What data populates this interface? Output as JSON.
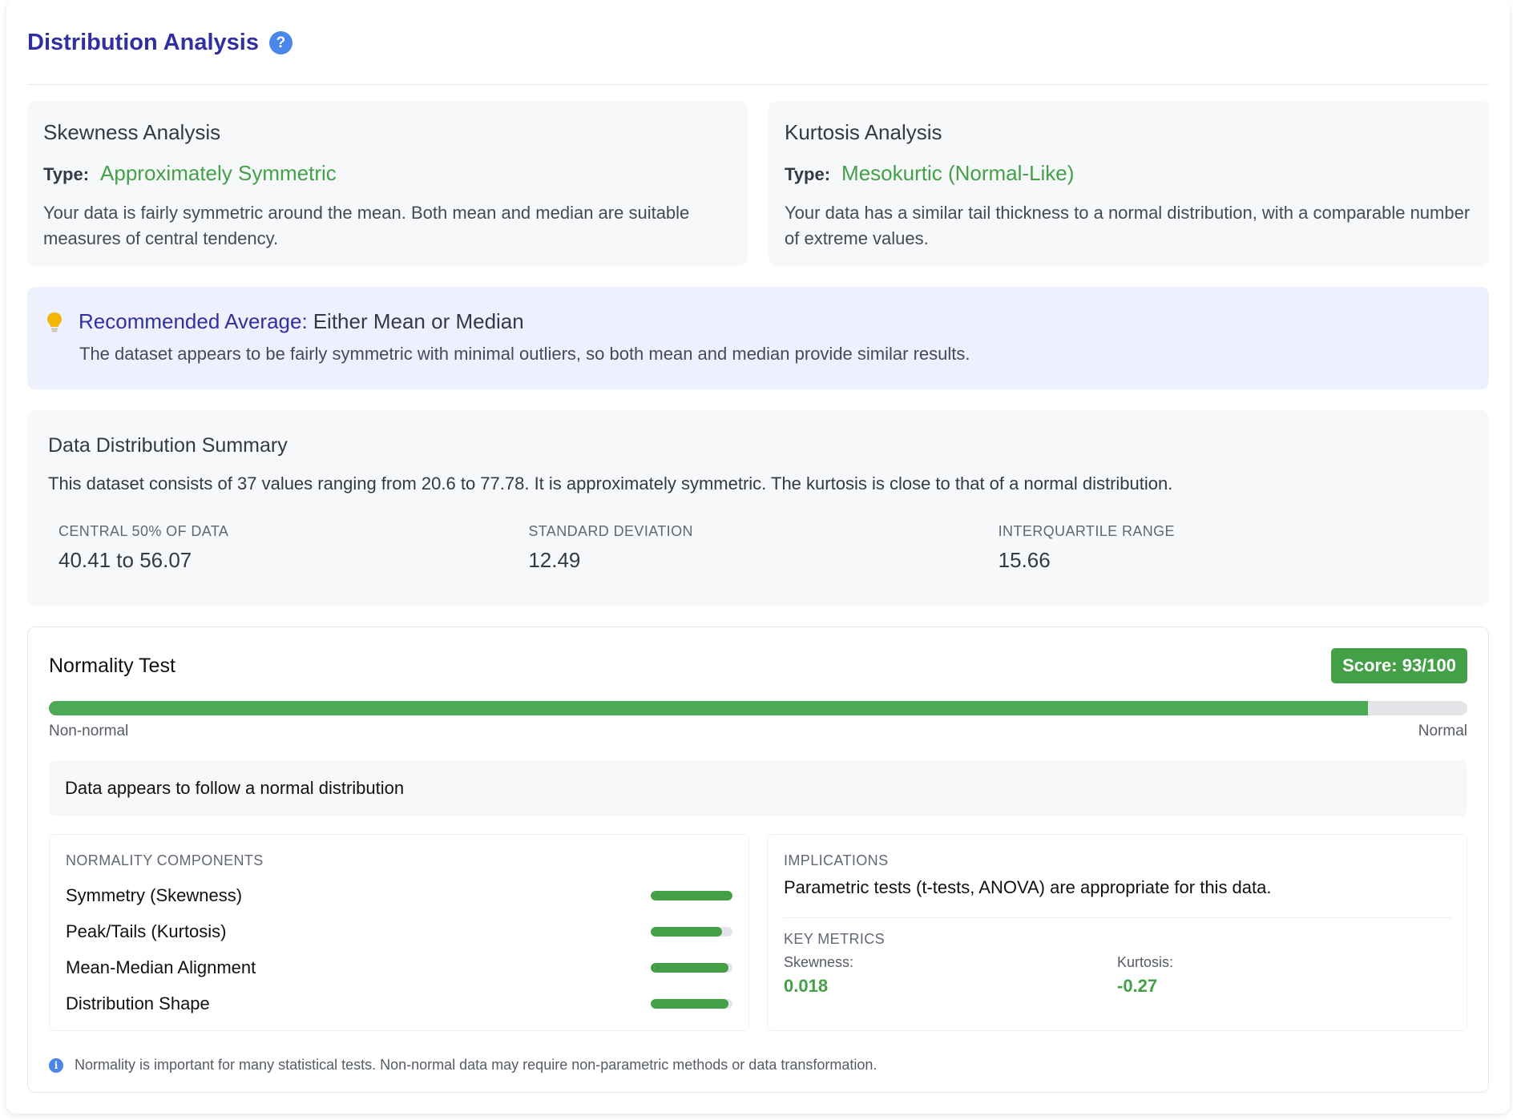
{
  "header": {
    "title": "Distribution Analysis",
    "help_icon": "?"
  },
  "skewness": {
    "title": "Skewness Analysis",
    "type_label": "Type:",
    "type_value": "Approximately Symmetric",
    "description": "Your data is fairly symmetric around the mean. Both mean and median are suitable measures of central tendency."
  },
  "kurtosis": {
    "title": "Kurtosis Analysis",
    "type_label": "Type:",
    "type_value": "Mesokurtic (Normal-Like)",
    "description": "Your data has a similar tail thickness to a normal distribution, with a comparable number of extreme values."
  },
  "recommendation": {
    "icon": "lightbulb-icon",
    "label": "Recommended Average:",
    "value": "Either Mean or Median",
    "description": "The dataset appears to be fairly symmetric with minimal outliers, so both mean and median provide similar results."
  },
  "summary": {
    "title": "Data Distribution Summary",
    "text": "This dataset consists of 37 values ranging from 20.6 to 77.78. It is approximately symmetric. The kurtosis is close to that of a normal distribution.",
    "stats": [
      {
        "label": "CENTRAL 50% OF DATA",
        "value": "40.41 to 56.07"
      },
      {
        "label": "STANDARD DEVIATION",
        "value": "12.49"
      },
      {
        "label": "INTERQUARTILE RANGE",
        "value": "15.66"
      }
    ]
  },
  "normality": {
    "title": "Normality Test",
    "score_label": "Score: 93/100",
    "score": 93,
    "scale_min_label": "Non-normal",
    "scale_max_label": "Normal",
    "verdict": "Data appears to follow a normal distribution",
    "components_label": "NORMALITY COMPONENTS",
    "components": [
      {
        "name": "Symmetry (Skewness)",
        "level": 100
      },
      {
        "name": "Peak/Tails (Kurtosis)",
        "level": 87
      },
      {
        "name": "Mean-Median Alignment",
        "level": 95
      },
      {
        "name": "Distribution Shape",
        "level": 95
      }
    ],
    "implications_label": "IMPLICATIONS",
    "implications_text": "Parametric tests (t-tests, ANOVA) are appropriate for this data.",
    "metrics_label": "KEY METRICS",
    "metrics": [
      {
        "name": "Skewness:",
        "value": "0.018"
      },
      {
        "name": "Kurtosis:",
        "value": "-0.27"
      }
    ],
    "footnote": "Normality is important for many statistical tests. Non-normal data may require non-parametric methods or data transformation.",
    "footnote_icon": "i"
  },
  "colors": {
    "title": "#3230a0",
    "accent_green": "#43a047",
    "info_blue": "#4b86e9",
    "recommend_bg": "#eef1fd",
    "bulb": "#f2b705"
  }
}
